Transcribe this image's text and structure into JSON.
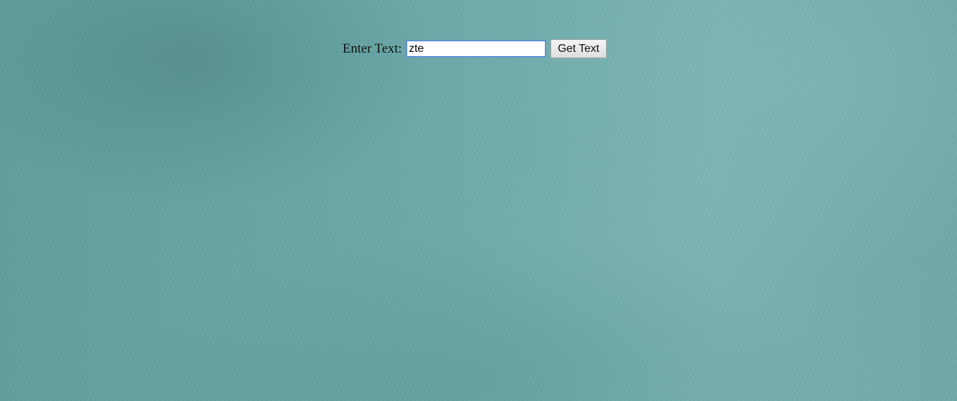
{
  "form": {
    "label": "Enter Text:",
    "input_value": "zte",
    "input_placeholder": "",
    "button_label": "Get Text"
  },
  "colors": {
    "background": "#6aa6a6",
    "input_focus_border": "#5f8fd0"
  }
}
